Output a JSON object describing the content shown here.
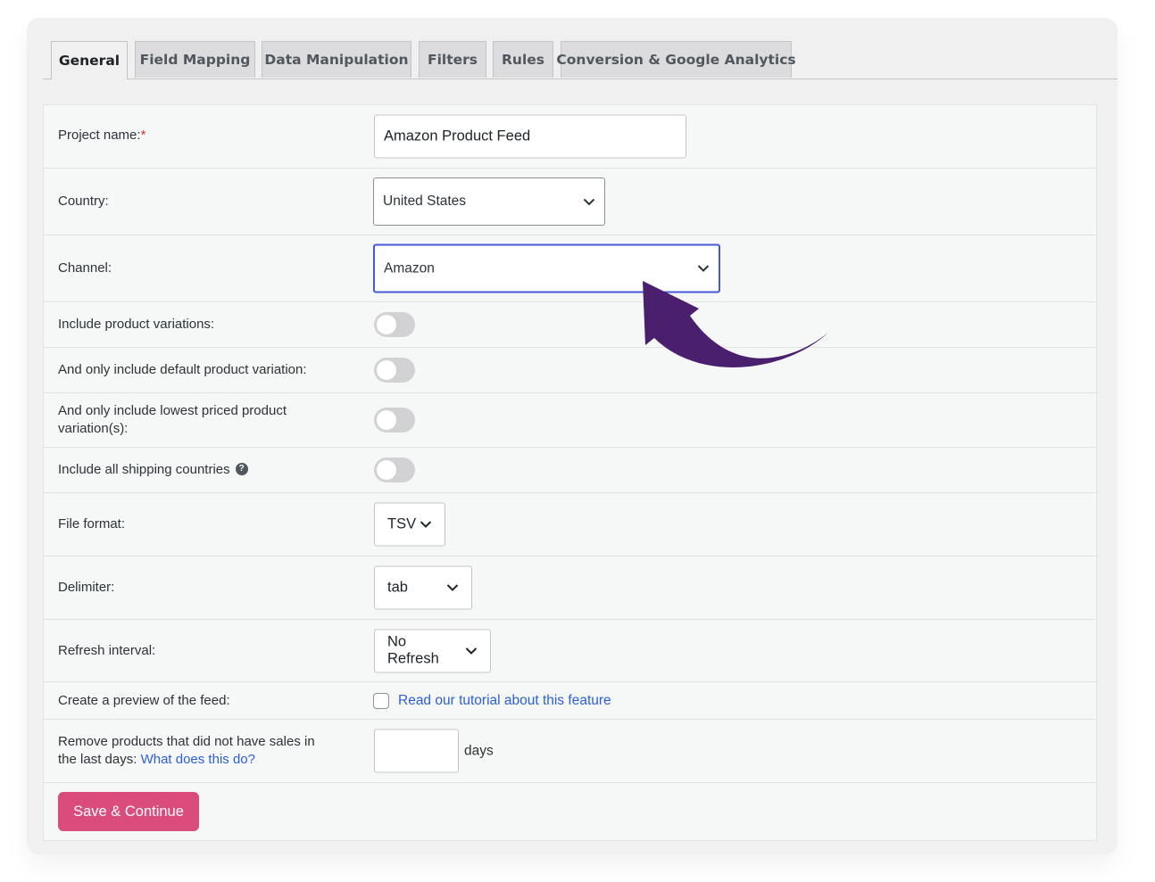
{
  "tabs": [
    {
      "label": "General",
      "active": true
    },
    {
      "label": "Field Mapping"
    },
    {
      "label": "Data Manipulation"
    },
    {
      "label": "Filters"
    },
    {
      "label": "Rules"
    },
    {
      "label": "Conversion & Google Analytics"
    }
  ],
  "form": {
    "project_name": {
      "label": "Project name:",
      "required_mark": "*",
      "value": "Amazon Product Feed"
    },
    "country": {
      "label": "Country:",
      "value": "United States"
    },
    "channel": {
      "label": "Channel:",
      "value": "Amazon"
    },
    "include_variations": {
      "label": "Include product variations:",
      "on": false
    },
    "default_variation": {
      "label": "And only include default product variation:",
      "on": false
    },
    "lowest_priced": {
      "label_line1": "And only include lowest priced product",
      "label_line2": "variation(s):",
      "on": false
    },
    "shipping_countries": {
      "label": "Include all shipping countries",
      "help_icon": "?",
      "on": false
    },
    "file_format": {
      "label": "File format:",
      "value": "TSV"
    },
    "delimiter": {
      "label": "Delimiter:",
      "value": "tab"
    },
    "refresh_interval": {
      "label": "Refresh interval:",
      "value": "No Refresh"
    },
    "preview": {
      "label": "Create a preview of the feed:",
      "checked": false,
      "link": "Read our tutorial about this feature"
    },
    "remove_products": {
      "label_line1": "Remove products that did not have sales in",
      "label_line2": "the last days:",
      "link": "What does this do?",
      "value": "",
      "suffix": "days"
    }
  },
  "save_button": {
    "label": "Save & Continue"
  },
  "colors": {
    "accent_button": "#d94c7c",
    "focus_border": "#4659d8",
    "link": "#2c5fd6",
    "arrow": "#4a1f6e"
  },
  "annotation": {
    "icon": "curved-arrow-icon",
    "points_to": "channel-select"
  }
}
